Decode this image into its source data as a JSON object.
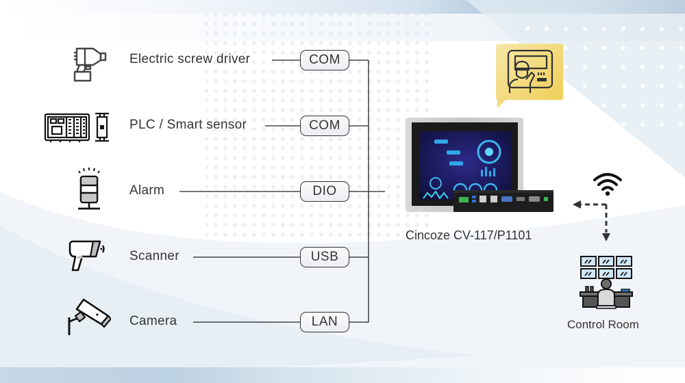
{
  "devices": [
    {
      "label": "Electric screw driver",
      "icon": "screwdriver-icon",
      "port": "COM"
    },
    {
      "label": "PLC / Smart sensor",
      "icon": "plc-sensor-icon",
      "port": "COM"
    },
    {
      "label": "Alarm",
      "icon": "alarm-light-icon",
      "port": "DIO"
    },
    {
      "label": "Scanner",
      "icon": "barcode-scanner-icon",
      "port": "USB"
    },
    {
      "label": "Camera",
      "icon": "security-camera-icon",
      "port": "LAN"
    }
  ],
  "product": {
    "name": "Cincoze CV-117/P1101",
    "icon": "panel-pc-icon",
    "hmi_bubble_icon": "operator-touchscreen-icon"
  },
  "control_room": {
    "label": "Control Room",
    "icon": "control-room-icon",
    "link_icon": "wifi-icon"
  },
  "colors": {
    "line": "#222222",
    "bubble": "#f0d264",
    "text": "#333333",
    "accent_blue": "#1f5690"
  }
}
